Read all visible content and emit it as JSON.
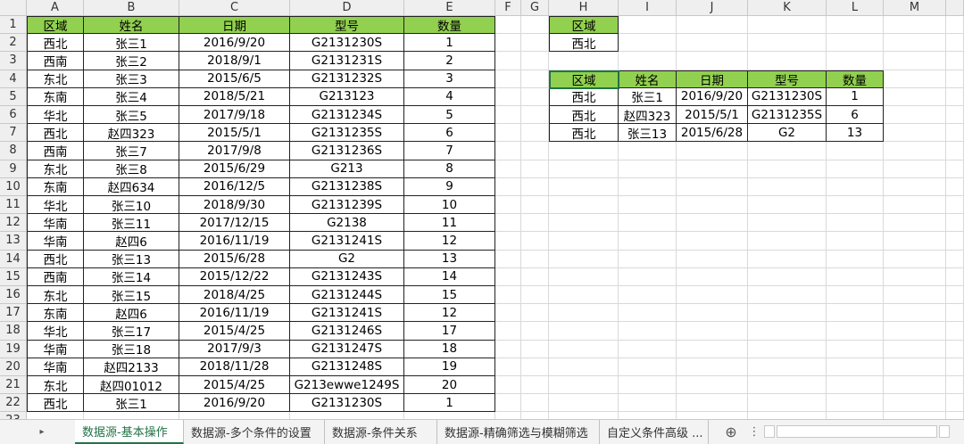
{
  "columns": [
    "A",
    "B",
    "C",
    "D",
    "E",
    "F",
    "G",
    "H",
    "I",
    "J",
    "K",
    "L",
    "M"
  ],
  "rows": [
    "1",
    "2",
    "3",
    "4",
    "5",
    "6",
    "7",
    "8",
    "9",
    "10",
    "11",
    "12",
    "13",
    "14",
    "15",
    "16",
    "17",
    "18",
    "19",
    "20",
    "21",
    "22",
    "23"
  ],
  "main_table": {
    "headers": [
      "区域",
      "姓名",
      "日期",
      "型号",
      "数量"
    ],
    "rows": [
      [
        "西北",
        "张三1",
        "2016/9/20",
        "G2131230S",
        "1"
      ],
      [
        "西南",
        "张三2",
        "2018/9/1",
        "G2131231S",
        "2"
      ],
      [
        "东北",
        "张三3",
        "2015/6/5",
        "G2131232S",
        "3"
      ],
      [
        "东南",
        "张三4",
        "2018/5/21",
        "G213123",
        "4"
      ],
      [
        "华北",
        "张三5",
        "2017/9/18",
        "G2131234S",
        "5"
      ],
      [
        "西北",
        "赵四323",
        "2015/5/1",
        "G2131235S",
        "6"
      ],
      [
        "西南",
        "张三7",
        "2017/9/8",
        "G2131236S",
        "7"
      ],
      [
        "东北",
        "张三8",
        "2015/6/29",
        "G213",
        "8"
      ],
      [
        "东南",
        "赵四634",
        "2016/12/5",
        "G2131238S",
        "9"
      ],
      [
        "华北",
        "张三10",
        "2018/9/30",
        "G2131239S",
        "10"
      ],
      [
        "华南",
        "张三11",
        "2017/12/15",
        "G2138",
        "11"
      ],
      [
        "华南",
        "赵四6",
        "2016/11/19",
        "G2131241S",
        "12"
      ],
      [
        "西北",
        "张三13",
        "2015/6/28",
        "G2",
        "13"
      ],
      [
        "西南",
        "张三14",
        "2015/12/22",
        "G2131243S",
        "14"
      ],
      [
        "东北",
        "张三15",
        "2018/4/25",
        "G2131244S",
        "15"
      ],
      [
        "东南",
        "赵四6",
        "2016/11/19",
        "G2131241S",
        "12"
      ],
      [
        "华北",
        "张三17",
        "2015/4/25",
        "G2131246S",
        "17"
      ],
      [
        "华南",
        "张三18",
        "2017/9/3",
        "G2131247S",
        "18"
      ],
      [
        "华南",
        "赵四2133",
        "2018/11/28",
        "G2131248S",
        "19"
      ],
      [
        "东北",
        "赵四01012",
        "2015/4/25",
        "G213ewwe1249S",
        "20"
      ],
      [
        "西北",
        "张三1",
        "2016/9/20",
        "G2131230S",
        "1"
      ]
    ]
  },
  "criteria": {
    "header": "区域",
    "value": "西北"
  },
  "result_table": {
    "headers": [
      "区域",
      "姓名",
      "日期",
      "型号",
      "数量"
    ],
    "rows": [
      [
        "西北",
        "张三1",
        "2016/9/20",
        "G2131230S",
        "1"
      ],
      [
        "西北",
        "赵四323",
        "2015/5/1",
        "G2131235S",
        "6"
      ],
      [
        "西北",
        "张三13",
        "2015/6/28",
        "G2",
        "13"
      ]
    ]
  },
  "tabs": [
    "数据源-基本操作",
    "数据源-多个条件的设置",
    "数据源-条件关系",
    "数据源-精确筛选与模糊筛选",
    "自定义条件高级 ..."
  ],
  "active_tab": 0,
  "icons": {
    "next_sheet": "play-right-icon",
    "add_sheet": "plus-circle-icon",
    "more": "ellipsis-icon"
  },
  "tabbar_glyphs": {
    "next": "▸",
    "add": "⊕",
    "more": "⋮"
  },
  "colors": {
    "header_green": "#92d050",
    "accent": "#217346"
  }
}
